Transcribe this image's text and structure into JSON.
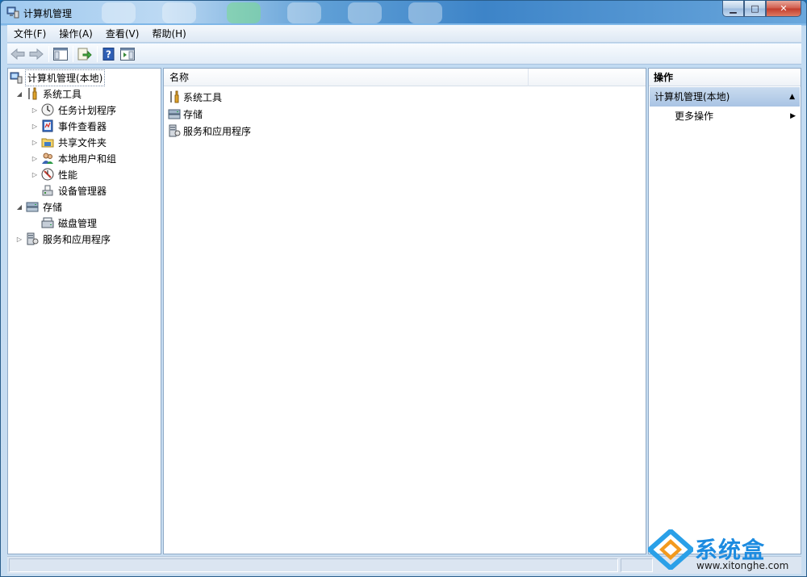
{
  "window": {
    "title": "计算机管理",
    "minimize": "▁",
    "restore": "□",
    "close": "✕"
  },
  "menu": [
    "文件(F)",
    "操作(A)",
    "查看(V)",
    "帮助(H)"
  ],
  "toolbar": {
    "icons": [
      "back-arrow-icon",
      "forward-arrow-icon",
      "show-hide-tree-icon",
      "export-list-icon",
      "help-icon",
      "show-hide-action-pane-icon"
    ]
  },
  "tree": {
    "root": "计算机管理(本地)",
    "system_tools": "系统工具",
    "task_scheduler": "任务计划程序",
    "event_viewer": "事件查看器",
    "shared_folders": "共享文件夹",
    "local_users": "本地用户和组",
    "performance": "性能",
    "device_manager": "设备管理器",
    "storage": "存储",
    "disk_management": "磁盘管理",
    "services_apps": "服务和应用程序"
  },
  "list": {
    "column_name": "名称",
    "items": [
      "系统工具",
      "存储",
      "服务和应用程序"
    ]
  },
  "actions": {
    "header": "操作",
    "section": "计算机管理(本地)",
    "more": "更多操作"
  },
  "watermark": {
    "brand": "系统盒",
    "url": "www.xitonghe.com"
  },
  "colors": {
    "accent": "#1c8be0",
    "selection": "#a9c4e4",
    "titlebar": "#3d84c8"
  }
}
